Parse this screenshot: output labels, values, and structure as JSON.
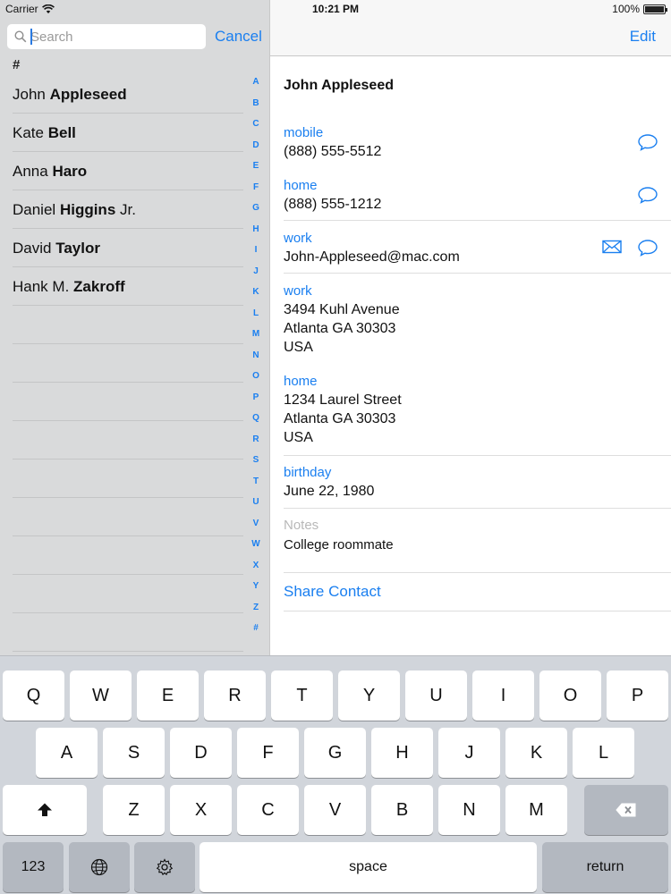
{
  "status_bar": {
    "carrier": "Carrier",
    "time": "10:21 PM",
    "battery": "100%"
  },
  "search": {
    "placeholder": "Search",
    "value": "",
    "cancel_label": "Cancel"
  },
  "list": {
    "section": "#",
    "contacts": [
      {
        "first": "John",
        "last": "Appleseed",
        "suffix": ""
      },
      {
        "first": "Kate",
        "last": "Bell",
        "suffix": ""
      },
      {
        "first": "Anna",
        "last": "Haro",
        "suffix": ""
      },
      {
        "first": "Daniel",
        "last": "Higgins",
        "suffix": " Jr."
      },
      {
        "first": "David",
        "last": "Taylor",
        "suffix": ""
      },
      {
        "first": "Hank M.",
        "last": "Zakroff",
        "suffix": ""
      }
    ]
  },
  "index_letters": [
    "A",
    "B",
    "C",
    "D",
    "E",
    "F",
    "G",
    "H",
    "I",
    "J",
    "K",
    "L",
    "M",
    "N",
    "O",
    "P",
    "Q",
    "R",
    "S",
    "T",
    "U",
    "V",
    "W",
    "X",
    "Y",
    "Z",
    "#"
  ],
  "detail": {
    "edit_label": "Edit",
    "name": "John Appleseed",
    "phones": [
      {
        "label": "mobile",
        "value": "(888) 555-5512"
      },
      {
        "label": "home",
        "value": "(888) 555-1212"
      }
    ],
    "email": {
      "label": "work",
      "value": "John-Appleseed@mac.com"
    },
    "addresses": [
      {
        "label": "work",
        "line1": "3494 Kuhl Avenue",
        "line2": "Atlanta GA 30303",
        "line3": "USA"
      },
      {
        "label": "home",
        "line1": "1234 Laurel Street",
        "line2": "Atlanta GA 30303",
        "line3": "USA"
      }
    ],
    "birthday": {
      "label": "birthday",
      "value": "June 22, 1980"
    },
    "notes": {
      "label": "Notes",
      "value": "College roommate"
    },
    "share_label": "Share Contact"
  },
  "keyboard": {
    "row1": [
      "Q",
      "W",
      "E",
      "R",
      "T",
      "Y",
      "U",
      "I",
      "O",
      "P"
    ],
    "row2": [
      "A",
      "S",
      "D",
      "F",
      "G",
      "H",
      "J",
      "K",
      "L"
    ],
    "row3": [
      "Z",
      "X",
      "C",
      "V",
      "B",
      "N",
      "M"
    ],
    "numbers_label": "123",
    "space_label": "space",
    "return_label": "return"
  },
  "colors": {
    "accent": "#1a7ff0",
    "keyboard_bg": "#d1d5db",
    "list_bg": "#d9dadb"
  }
}
